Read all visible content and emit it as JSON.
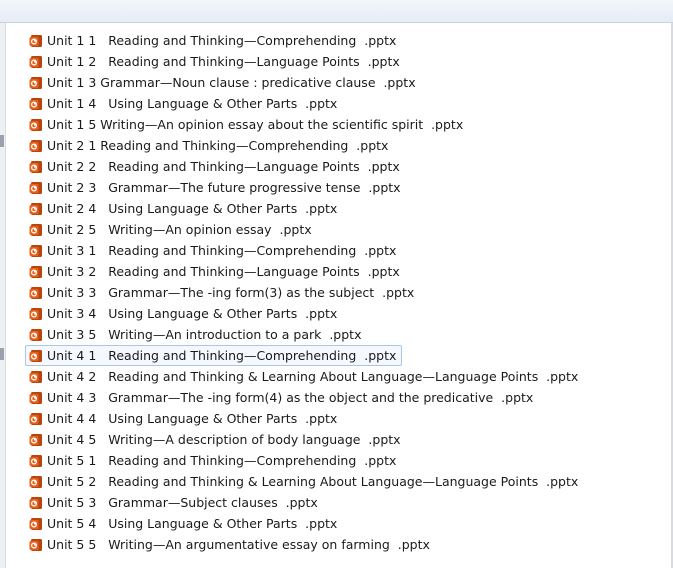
{
  "files": [
    {
      "name": "Unit 1 1   Reading and Thinking—Comprehending  .pptx",
      "icon": "pptx-file-icon",
      "selected": false
    },
    {
      "name": "Unit 1 2   Reading and Thinking—Language Points  .pptx",
      "icon": "pptx-file-icon",
      "selected": false
    },
    {
      "name": "Unit 1 3 Grammar—Noun clause : predicative clause  .pptx",
      "icon": "pptx-file-icon",
      "selected": false
    },
    {
      "name": "Unit 1 4   Using Language & Other Parts  .pptx",
      "icon": "pptx-file-icon",
      "selected": false
    },
    {
      "name": "Unit 1 5 Writing—An opinion essay about the scientific spirit  .pptx",
      "icon": "pptx-file-icon",
      "selected": false
    },
    {
      "name": "Unit 2 1 Reading and Thinking—Comprehending  .pptx",
      "icon": "pptx-file-icon",
      "selected": false
    },
    {
      "name": "Unit 2 2   Reading and Thinking—Language Points  .pptx",
      "icon": "pptx-file-icon",
      "selected": false
    },
    {
      "name": "Unit 2 3   Grammar—The future progressive tense  .pptx",
      "icon": "pptx-file-icon",
      "selected": false
    },
    {
      "name": "Unit 2 4   Using Language & Other Parts  .pptx",
      "icon": "pptx-file-icon",
      "selected": false
    },
    {
      "name": "Unit 2 5   Writing—An opinion essay  .pptx",
      "icon": "pptx-file-icon",
      "selected": false
    },
    {
      "name": "Unit 3 1   Reading and Thinking—Comprehending  .pptx",
      "icon": "pptx-file-icon",
      "selected": false
    },
    {
      "name": "Unit 3 2   Reading and Thinking—Language Points  .pptx",
      "icon": "pptx-file-icon",
      "selected": false
    },
    {
      "name": "Unit 3 3   Grammar—The -ing form(3) as the subject  .pptx",
      "icon": "pptx-file-icon",
      "selected": false
    },
    {
      "name": "Unit 3 4   Using Language & Other Parts  .pptx",
      "icon": "pptx-file-icon",
      "selected": false
    },
    {
      "name": "Unit 3 5   Writing—An introduction to a park  .pptx",
      "icon": "pptx-file-icon",
      "selected": false
    },
    {
      "name": "Unit 4 1   Reading and Thinking—Comprehending  .pptx",
      "icon": "pptx-file-icon",
      "selected": true
    },
    {
      "name": "Unit 4 2   Reading and Thinking & Learning About Language—Language Points  .pptx",
      "icon": "pptx-file-icon",
      "selected": false
    },
    {
      "name": "Unit 4 3   Grammar—The -ing form(4) as the object and the predicative  .pptx",
      "icon": "pptx-file-icon",
      "selected": false
    },
    {
      "name": "Unit 4 4   Using Language & Other Parts  .pptx",
      "icon": "pptx-file-icon",
      "selected": false
    },
    {
      "name": "Unit 4 5   Writing—A description of body language  .pptx",
      "icon": "pptx-file-icon",
      "selected": false
    },
    {
      "name": "Unit 5 1   Reading and Thinking—Comprehending  .pptx",
      "icon": "pptx-file-icon",
      "selected": false
    },
    {
      "name": "Unit 5 2   Reading and Thinking & Learning About Language—Language Points  .pptx",
      "icon": "pptx-file-icon",
      "selected": false
    },
    {
      "name": "Unit 5 3   Grammar—Subject clauses  .pptx",
      "icon": "pptx-file-icon",
      "selected": false
    },
    {
      "name": "Unit 5 4   Using Language & Other Parts  .pptx",
      "icon": "pptx-file-icon",
      "selected": false
    },
    {
      "name": "Unit 5 5   Writing—An argumentative essay on farming  .pptx",
      "icon": "pptx-file-icon",
      "selected": false
    }
  ],
  "colors": {
    "icon_orange": "#e8611a",
    "icon_dark": "#b84510",
    "selection_border": "#a8c7e8",
    "text": "#1a1a1a"
  }
}
